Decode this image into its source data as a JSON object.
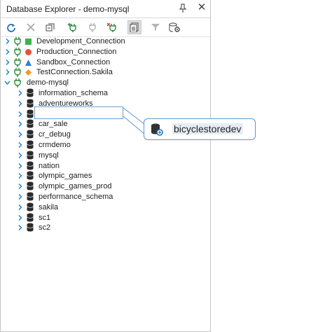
{
  "window": {
    "title": "Database Explorer - demo-mysql"
  },
  "toolbar": {
    "buttons": [
      {
        "name": "refresh-button",
        "icon": "refresh-icon"
      },
      {
        "name": "delete-button",
        "icon": "delete-icon"
      },
      {
        "name": "collapse-all-button",
        "icon": "collapse-all-icon"
      },
      {
        "name": "new-connection-button",
        "icon": "add-connection-icon"
      },
      {
        "name": "connect-button",
        "icon": "connect-icon"
      },
      {
        "name": "disconnect-button",
        "icon": "disconnect-icon"
      },
      {
        "name": "show-all-databases-button",
        "icon": "database-list-icon"
      },
      {
        "name": "filter-button",
        "icon": "filter-icon"
      },
      {
        "name": "settings-button",
        "icon": "database-settings-icon"
      }
    ]
  },
  "tree": {
    "connections": [
      {
        "label": "Development_Connection",
        "status_color": "#3bb54a",
        "status_shape": "square"
      },
      {
        "label": "Production_Connection",
        "status_color": "#e8503a",
        "status_shape": "circle"
      },
      {
        "label": "Sandbox_Connection",
        "status_color": "#2f7fd7",
        "status_shape": "triangle"
      },
      {
        "label": "TestConnection.Sakila",
        "status_color": "#f29c1f",
        "status_shape": "diamond"
      }
    ],
    "active_connection": {
      "label": "demo-mysql"
    },
    "databases": [
      {
        "label": "information_schema"
      },
      {
        "label": "adventureworks"
      },
      {
        "label": "bicyclestoredev"
      },
      {
        "label": "car_sale"
      },
      {
        "label": "cr_debug"
      },
      {
        "label": "crmdemo"
      },
      {
        "label": "mysql"
      },
      {
        "label": "nation"
      },
      {
        "label": "olympic_games"
      },
      {
        "label": "olympic_games_prod"
      },
      {
        "label": "performance_schema"
      },
      {
        "label": "sakila"
      },
      {
        "label": "sc1"
      },
      {
        "label": "sc2"
      }
    ]
  },
  "callout": {
    "label": "bicyclestoredev"
  },
  "colors": {
    "accent": "#5c97cf",
    "plug": "#2e8b3e",
    "tree_arrow": "#1e88c8"
  }
}
